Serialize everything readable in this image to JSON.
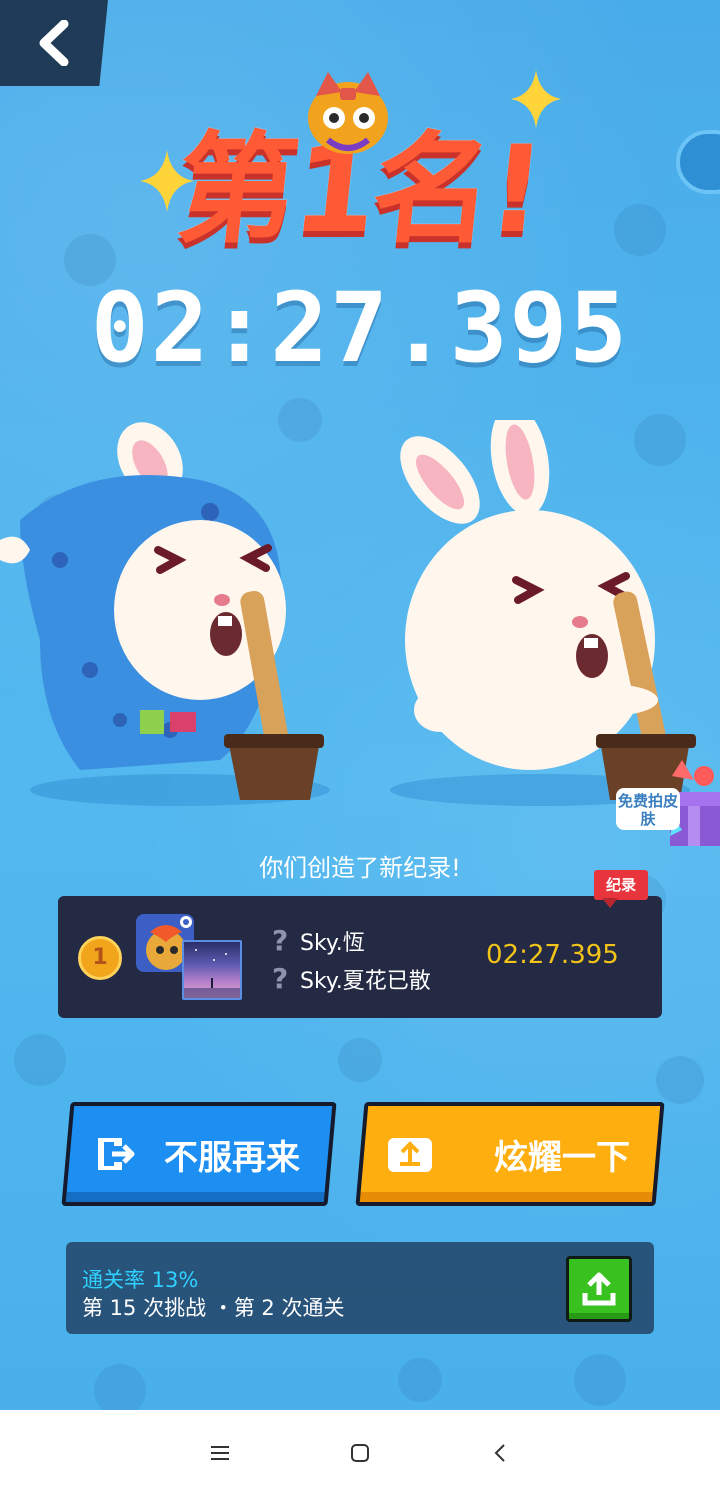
{
  "result": {
    "rank_title": "第1名!",
    "time": "02:27.395",
    "message": "你们创造了新纪录!"
  },
  "skin_promo": {
    "label": "免费拍皮肤"
  },
  "record_card": {
    "tag": "纪录",
    "rank": "1",
    "players": [
      {
        "marker": "?",
        "name": "Sky.恆"
      },
      {
        "marker": "?",
        "name": "Sky.夏花已散"
      }
    ],
    "time": "02:27.395"
  },
  "actions": {
    "retry_label": "不服再来",
    "share_label": "炫耀一下"
  },
  "stats": {
    "pass_rate": "通关率 13%",
    "attempts": "第 15 次挑战 ・第 2 次通关"
  },
  "icons": {
    "back": "back-arrow-icon",
    "retry": "retry-icon",
    "share": "share-icon",
    "upload": "upload-icon"
  },
  "colors": {
    "background": "#4fb5ee",
    "rank_title": "#ff5a36",
    "record_time": "#f2c318",
    "pass_rate": "#2fd2ff",
    "retry_button": "#1e8ff2",
    "share_button": "#ffae10",
    "upload_button": "#38c11f"
  }
}
